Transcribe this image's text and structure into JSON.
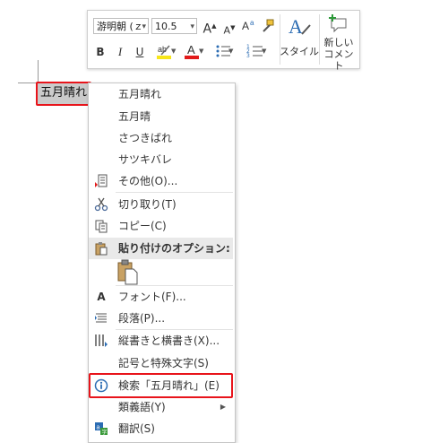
{
  "toolbar": {
    "font_name": "游明朝 (ｚ",
    "font_size": "10.5",
    "grow_font": "A",
    "shrink_font": "A",
    "bold": "B",
    "italic": "I",
    "underline": "U",
    "font_color_letter": "A",
    "styles_label": "スタイル",
    "new_comment_line1": "新しい",
    "new_comment_line2": "コメント",
    "highlight_color": "#f7e61a",
    "font_color": "#e21b1b",
    "accent": "#2b6cb3"
  },
  "document": {
    "selected_text": "五月晴れ"
  },
  "context_menu": {
    "suggestions": [
      "五月晴れ",
      "五月晴",
      "さつきばれ",
      "サツキバレ"
    ],
    "other": "その他(O)...",
    "cut": "切り取り(T)",
    "copy": "コピー(C)",
    "paste_options": "貼り付けのオプション:",
    "font": "フォント(F)...",
    "paragraph": "段落(P)...",
    "text_direction": "縦書きと横書き(X)...",
    "symbols": "記号と特殊文字(S)",
    "search": "検索「五月晴れ」(E)",
    "synonyms": "類義語(Y)",
    "translate": "翻訳(S)"
  },
  "highlight_color": "#e8141b"
}
